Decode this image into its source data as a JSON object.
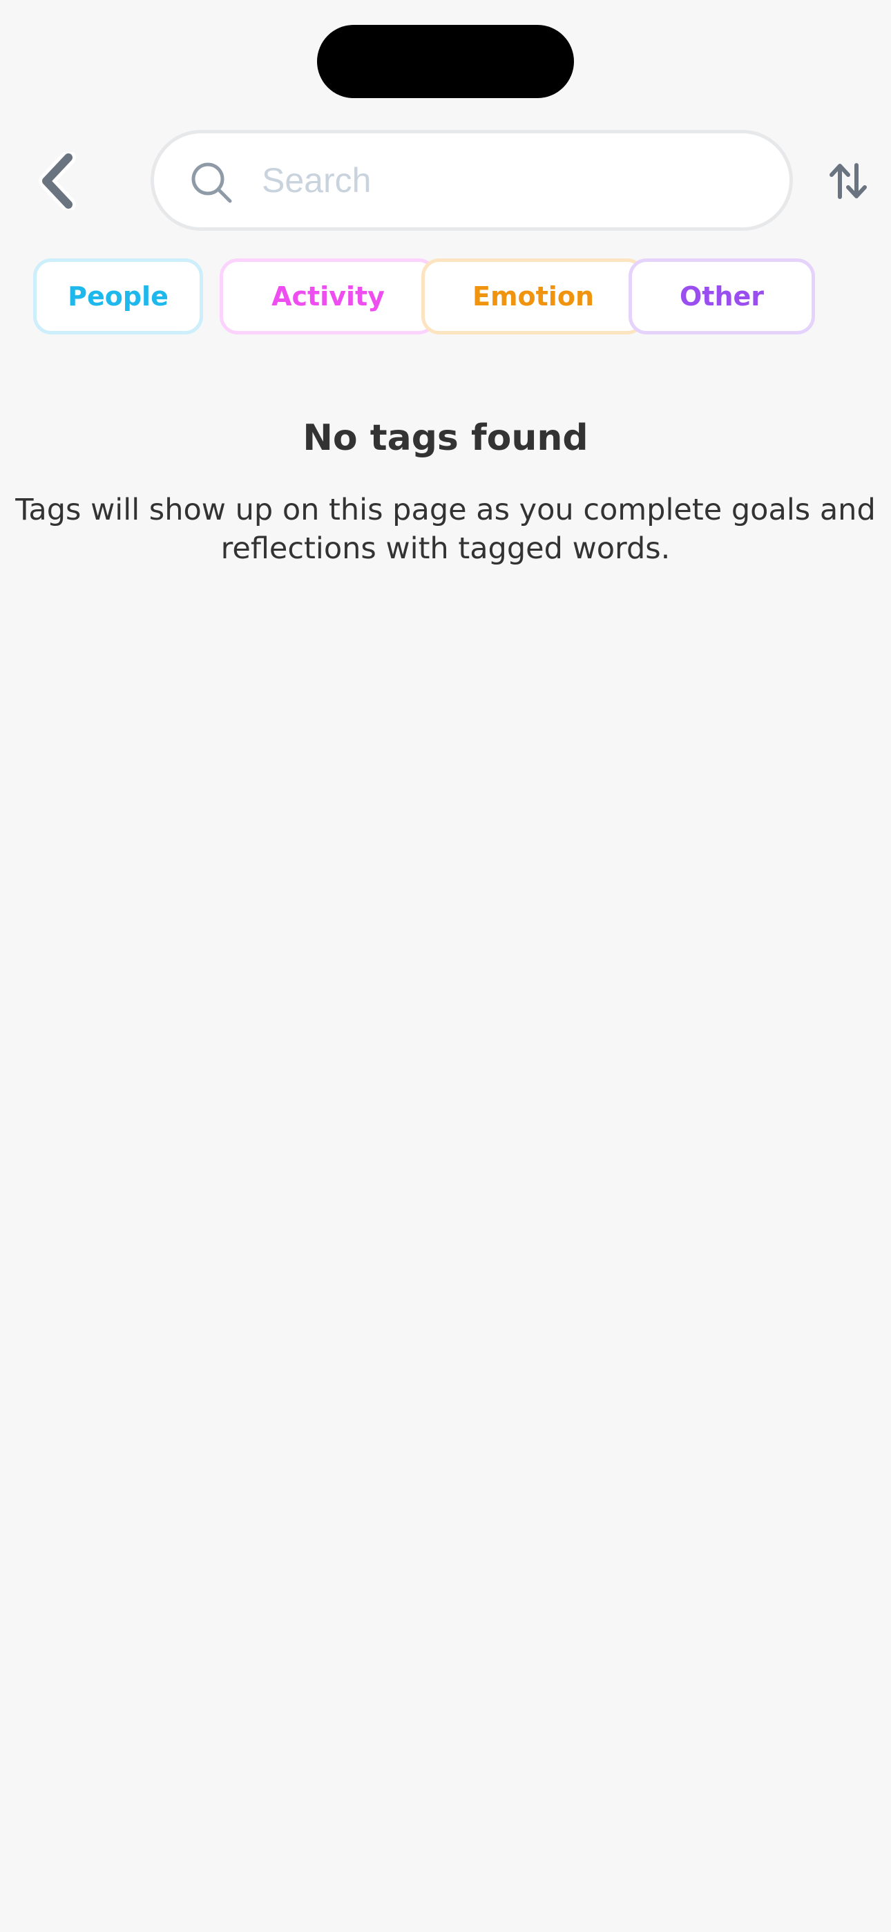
{
  "search": {
    "placeholder": "Search",
    "value": ""
  },
  "icons": {
    "back": "chevron-left-icon",
    "search": "magnifier-icon",
    "sort": "sort-arrows-icon"
  },
  "filters": [
    {
      "label": "People",
      "text_color": "#1fb8ec",
      "border_color": "#cdeefb"
    },
    {
      "label": "Activity",
      "text_color": "#ee4ef0",
      "border_color": "#fbd3fc"
    },
    {
      "label": "Emotion",
      "text_color": "#f0940f",
      "border_color": "#fde4c1"
    },
    {
      "label": "Other",
      "text_color": "#9a4ef0",
      "border_color": "#e5d3fc"
    }
  ],
  "empty_state": {
    "title": "No tags found",
    "description_line1": "Tags will show up on this page as you complete goals and",
    "description_line2": "reflections with tagged words."
  },
  "colors": {
    "background": "#f7f7f8",
    "icon": "#6a7480",
    "text": "#333333"
  }
}
